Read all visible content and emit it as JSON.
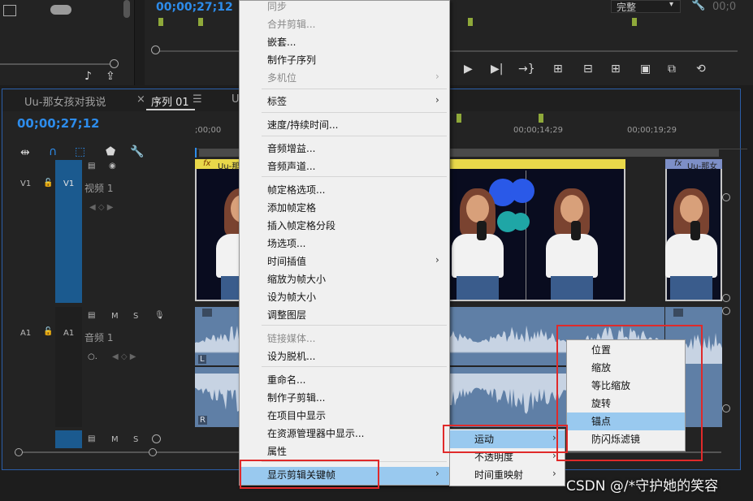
{
  "top_monitor": {
    "timecode": "00;00;27;12",
    "quality": "完整",
    "timecode_right": "00;0"
  },
  "timeline": {
    "tabs": [
      {
        "label": "Uu-那女孩对我说"
      },
      {
        "label": "序列 01"
      },
      {
        "label": "U"
      }
    ],
    "close_symbol": "×",
    "menu_symbol": "☰",
    "timecode": "00;00;27;12",
    "ruler_labels": [
      ";00;00",
      "00;00;14;29",
      "00;00;19;29"
    ],
    "tracks": {
      "v1_left": "V1",
      "v1_target": "V1",
      "v1_name": "视频 1",
      "a1_left": "A1",
      "a1_target": "A1",
      "a1_name": "音频 1",
      "m_label": "M",
      "s_label": "S"
    },
    "clip_title_1": "Uu-那",
    "clip_title_2": "Uu-那女",
    "fx_badge": "fx",
    "channel_l": "L",
    "channel_r": "R"
  },
  "context_menu": {
    "items": [
      {
        "label": "同步",
        "disabled": true
      },
      {
        "label": "合并剪辑...",
        "disabled": true
      },
      {
        "label": "嵌套...",
        "disabled": false
      },
      {
        "label": "制作子序列",
        "disabled": false
      },
      {
        "label": "多机位",
        "disabled": true
      },
      {
        "label": "标签",
        "disabled": false
      },
      {
        "label": "速度/持续时间...",
        "disabled": false
      },
      {
        "label": "音频增益...",
        "disabled": false
      },
      {
        "label": "音频声道...",
        "disabled": false
      },
      {
        "label": "帧定格选项...",
        "disabled": false
      },
      {
        "label": "添加帧定格",
        "disabled": false
      },
      {
        "label": "插入帧定格分段",
        "disabled": false
      },
      {
        "label": "场选项...",
        "disabled": false
      },
      {
        "label": "时间插值",
        "disabled": false
      },
      {
        "label": "缩放为帧大小",
        "disabled": false
      },
      {
        "label": "设为帧大小",
        "disabled": false
      },
      {
        "label": "调整图层",
        "disabled": false
      },
      {
        "label": "链接媒体...",
        "disabled": true
      },
      {
        "label": "设为脱机...",
        "disabled": false
      },
      {
        "label": "重命名...",
        "disabled": false
      },
      {
        "label": "制作子剪辑...",
        "disabled": false
      },
      {
        "label": "在项目中显示",
        "disabled": false
      },
      {
        "label": "在资源管理器中显示...",
        "disabled": false
      },
      {
        "label": "属性",
        "disabled": false
      },
      {
        "label": "显示剪辑关键帧",
        "disabled": false
      }
    ]
  },
  "submenu_keyframes": {
    "items": [
      {
        "label": "运动"
      },
      {
        "label": "不透明度"
      },
      {
        "label": "时间重映射"
      }
    ]
  },
  "submenu_motion": {
    "items": [
      {
        "label": "位置"
      },
      {
        "label": "缩放"
      },
      {
        "label": "等比缩放"
      },
      {
        "label": "旋转"
      },
      {
        "label": "锚点"
      },
      {
        "label": "防闪烁滤镜"
      }
    ]
  },
  "submenu_arrow": "›",
  "watermark": "CSDN @/*守护她的笑容",
  "colors": {
    "accent_timecode": "#2d8ceb",
    "menu_highlight": "#99c9ef",
    "annotation_red": "#e02a2a",
    "clip_selected_header": "#e9d84a",
    "audio_clip": "#5f7fa6"
  }
}
